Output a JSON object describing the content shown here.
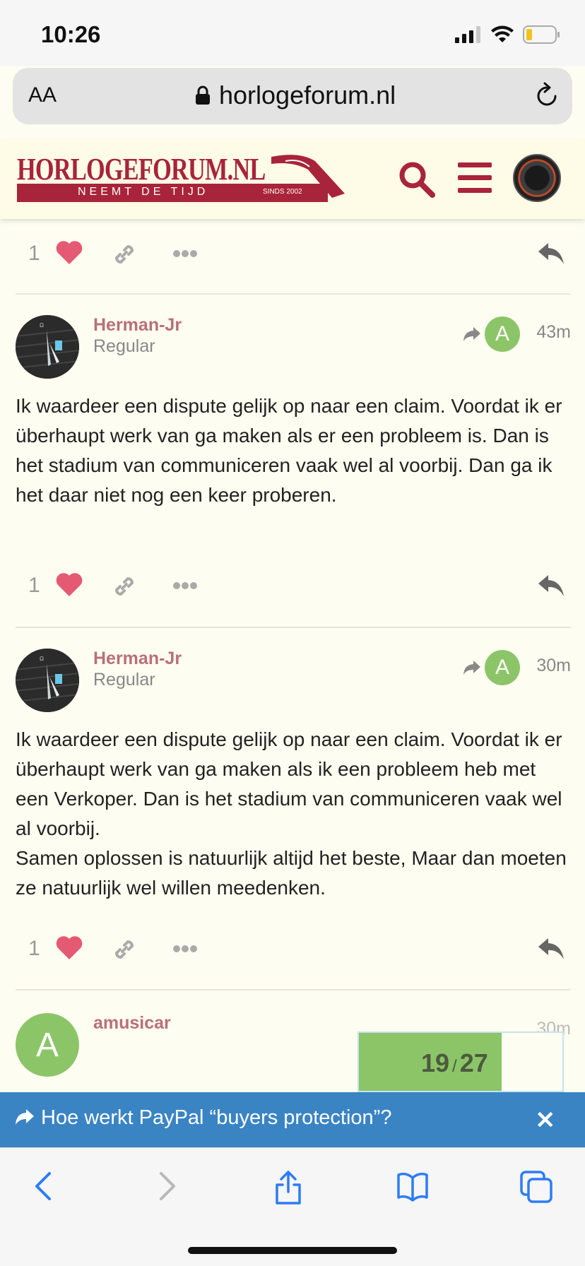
{
  "status": {
    "time": "10:26"
  },
  "browser": {
    "aa_label": "AA",
    "url": "horlogeforum.nl"
  },
  "site": {
    "logo_title": "HORLOGEFORUM.NL",
    "logo_tagline": "NEEMT DE TIJD",
    "logo_since": "SINDS 2002"
  },
  "actions_top": {
    "like_count": "1"
  },
  "posts": [
    {
      "username": "Herman-Jr",
      "user_title": "Regular",
      "reply_avatar": "A",
      "time": "43m",
      "body": [
        "Ik waardeer een dispute gelijk op naar een claim. Voordat ik er überhaupt werk van ga maken als er een probleem is. Dan is het stadium van communiceren vaak wel al voorbij. Dan ga ik het daar niet nog een keer proberen."
      ],
      "like_count": "1"
    },
    {
      "username": "Herman-Jr",
      "user_title": "Regular",
      "reply_avatar": "A",
      "time": "30m",
      "body": [
        "Ik waardeer een dispute gelijk op naar een claim. Voordat ik er überhaupt werk van ga maken als ik een probleem heb met een Verkoper. Dan is het stadium van communiceren vaak wel al voorbij.",
        "Samen oplossen is natuurlijk altijd het beste, Maar dan moeten ze natuurlijk wel willen meedenken."
      ],
      "like_count": "1"
    },
    {
      "username": "amusicar",
      "avatar_letter": "A",
      "time": "30m"
    }
  ],
  "progress": {
    "current": "19",
    "separator": "/",
    "total": "27",
    "fraction": 0.7
  },
  "topic_bar": {
    "title": "Hoe werkt PayPal “buyers protection”?",
    "close": "✕"
  },
  "icons": {
    "like": "heart-icon",
    "link": "link-icon",
    "more": "more-icon",
    "reply": "reply-icon",
    "share": "share-icon"
  },
  "colors": {
    "brand": "#a8243a",
    "like": "#e45a72",
    "green": "#8cc568",
    "topic_bar": "#3a84c4",
    "username": "#b8707a"
  }
}
